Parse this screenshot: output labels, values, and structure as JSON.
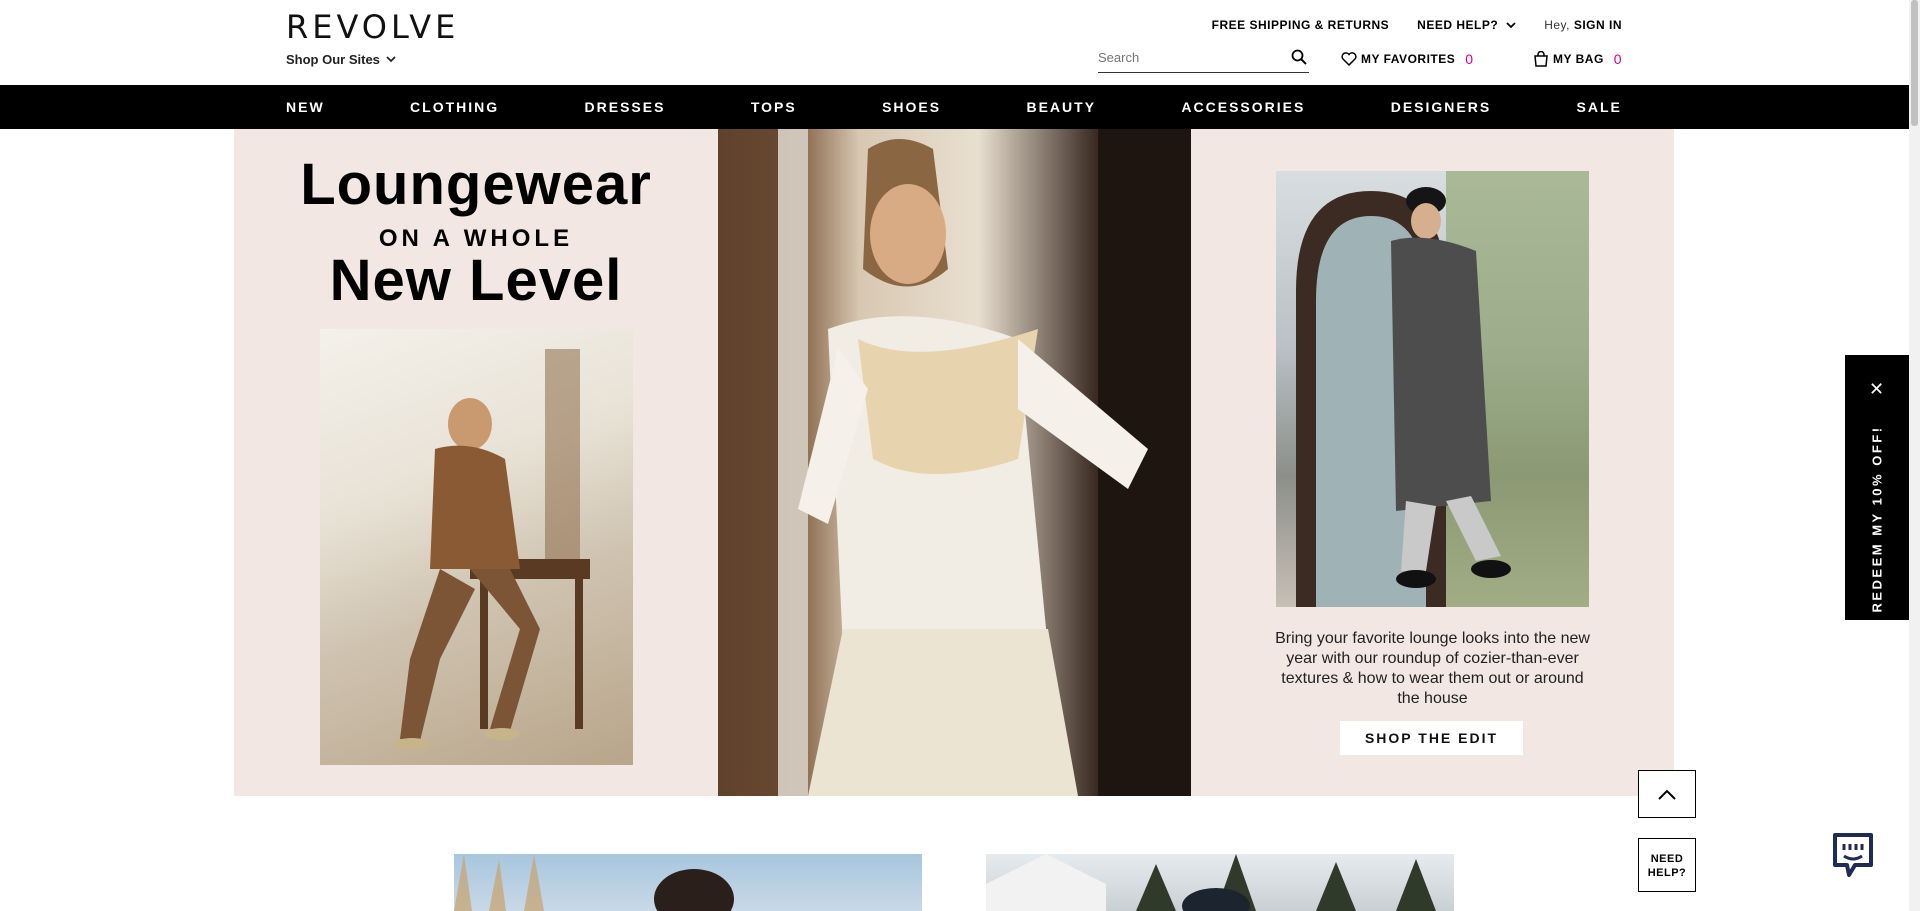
{
  "header": {
    "logo": "REVOLVE",
    "shop_sites": "Shop Our Sites",
    "free_shipping": "FREE SHIPPING & RETURNS",
    "need_help": "NEED HELP?",
    "greeting": "Hey,",
    "sign_in": "SIGN IN",
    "search_placeholder": "Search",
    "favorites_label": "MY FAVORITES",
    "favorites_count": "0",
    "bag_label": "MY BAG",
    "bag_count": "0"
  },
  "nav": {
    "items": [
      "NEW",
      "CLOTHING",
      "DRESSES",
      "TOPS",
      "SHOES",
      "BEAUTY",
      "ACCESSORIES",
      "DESIGNERS",
      "SALE"
    ]
  },
  "hero": {
    "title_line1": "Loungewear",
    "title_line2": "ON A WHOLE",
    "title_line3": "New Level",
    "description": "Bring your favorite lounge looks into the new year with our roundup of cozier-than-ever textures & how to wear them out or around the house",
    "cta": "SHOP THE EDIT"
  },
  "promo": {
    "text": "REDEEM MY 10% OFF!"
  },
  "widgets": {
    "need_help_line1": "NEED",
    "need_help_line2": "HELP?"
  },
  "colors": {
    "accent": "#d6008a",
    "hero_bg": "#f2e7e2",
    "nav_bg": "#000000"
  }
}
